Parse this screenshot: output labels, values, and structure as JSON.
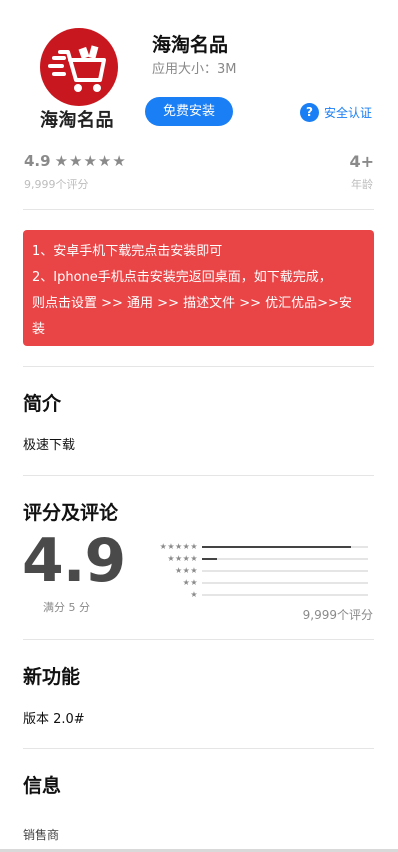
{
  "app": {
    "name": "海淘名品",
    "logo_text": "海淘名品",
    "size": "应用大小：3M",
    "install_label": "免费安装",
    "verify_label": "安全认证",
    "verify_icon_glyph": "?"
  },
  "rating_summary": {
    "score": "4.9",
    "stars": "★★★★★",
    "count": "9,999个评分",
    "age": "4+",
    "age_label": "年龄"
  },
  "notice": {
    "lines": [
      "1、安卓手机下载完点击安装即可",
      "2、Iphone手机点击安装完返回桌面，如下载完成，",
      "则点击设置 >> 通用 >> 描述文件 >> 优汇优品>>安",
      "装"
    ]
  },
  "intro": {
    "title": "简介",
    "body": "极速下载"
  },
  "ratings": {
    "title": "评分及评论",
    "score": "4.9",
    "out_of": "满分 5 分",
    "total": "9,999个评分",
    "distribution": [
      {
        "stars": "★★★★★",
        "fraction": 0.9
      },
      {
        "stars": "★★★★",
        "fraction": 0.09
      },
      {
        "stars": "★★★",
        "fraction": 0
      },
      {
        "stars": "★★",
        "fraction": 0
      },
      {
        "stars": "★",
        "fraction": 0
      }
    ]
  },
  "whats_new": {
    "title": "新功能",
    "body": "版本 2.0#"
  },
  "info": {
    "title": "信息",
    "seller_label": "销售商"
  },
  "colors": {
    "accent": "#1a7ef5",
    "notice_bg": "#e94547",
    "logo_red": "#c8171e"
  }
}
